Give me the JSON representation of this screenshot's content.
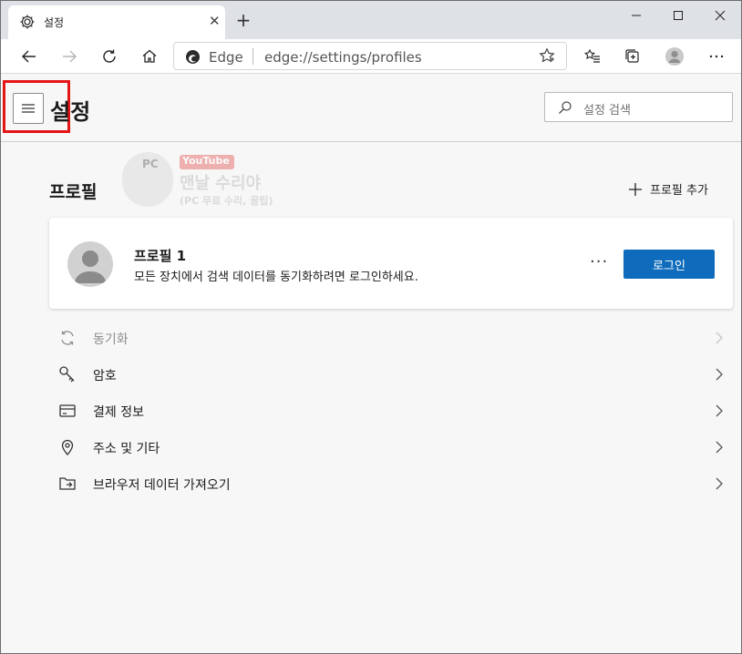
{
  "browser": {
    "tab_title": "설정",
    "tab_close": "✕",
    "new_tab": "+",
    "address_site": "Edge",
    "address_url": "edge://settings/profiles"
  },
  "settings": {
    "page_title": "설정",
    "search_placeholder": "설정 검색"
  },
  "profile_section": {
    "title": "프로필",
    "add_profile_label": "프로필 추가"
  },
  "profile_card": {
    "name": "프로필 1",
    "description": "모든 장치에서 검색 데이터를 동기화하려면 로그인하세요.",
    "more_label": "···",
    "login_label": "로그인"
  },
  "watermark": {
    "pc_text": "PC",
    "youtube_text": "YouTube",
    "big_text": "맨날 수리야",
    "small_text": "(PC 무료 수리, 꿀팁)"
  },
  "menu": {
    "items": [
      {
        "label": "동기화",
        "icon": "sync-icon",
        "disabled": true
      },
      {
        "label": "암호",
        "icon": "key-icon",
        "disabled": false
      },
      {
        "label": "결제 정보",
        "icon": "credit-card-icon",
        "disabled": false
      },
      {
        "label": "주소 및 기타",
        "icon": "location-pin-icon",
        "disabled": false
      },
      {
        "label": "브라우저 데이터 가져오기",
        "icon": "import-folder-icon",
        "disabled": false
      }
    ]
  },
  "colors": {
    "accent": "#0f6cbd",
    "highlight_box": "#e31515",
    "page_bg": "#f7f7f7"
  }
}
